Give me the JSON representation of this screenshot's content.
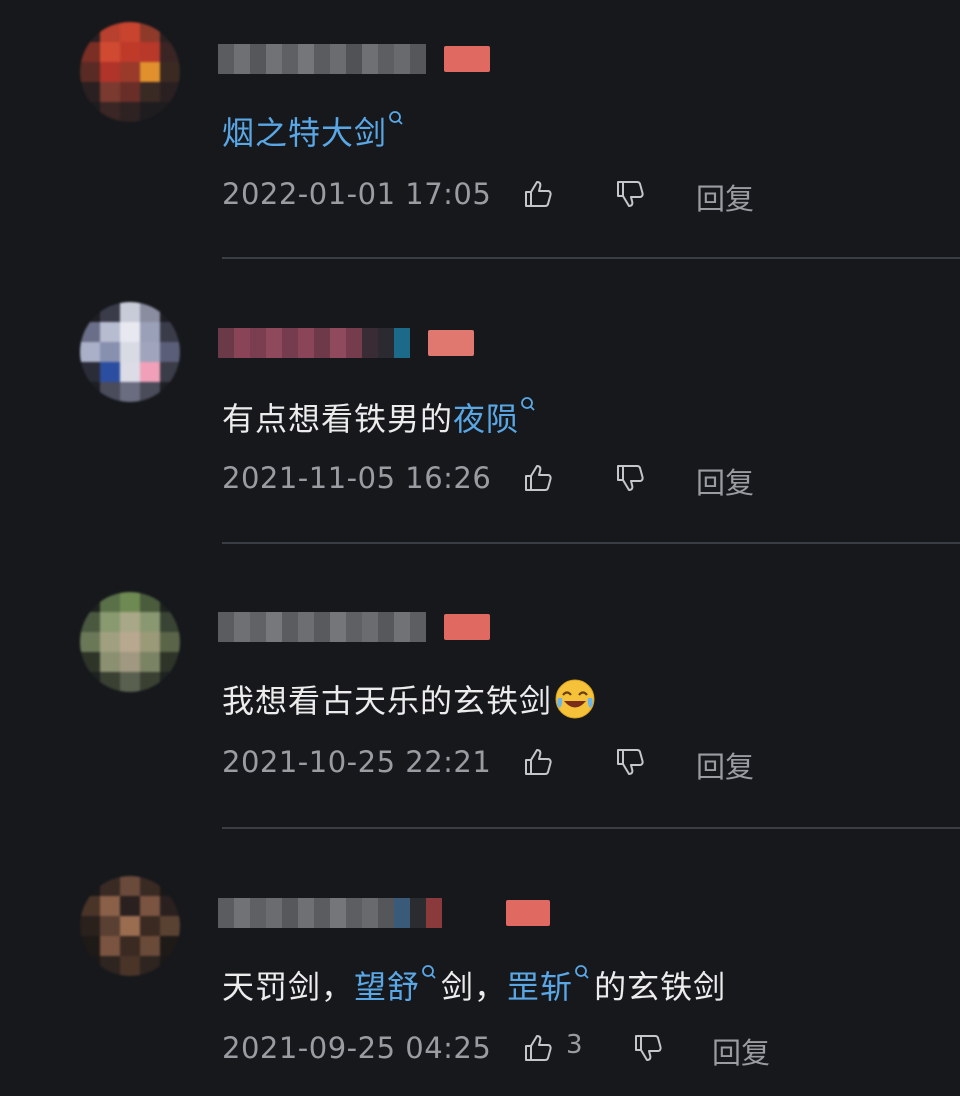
{
  "comments": [
    {
      "text_parts": [
        {
          "text": "烟之特大剑",
          "link": true
        }
      ],
      "time": "2022-01-01 17:05",
      "reply": "回复"
    },
    {
      "text_parts": [
        {
          "text": "有点想看铁男的",
          "link": false
        },
        {
          "text": "夜陨",
          "link": true
        }
      ],
      "time": "2021-11-05 16:26",
      "reply": "回复"
    },
    {
      "text_parts": [
        {
          "text": "我想看古天乐的玄铁剑",
          "link": false
        }
      ],
      "time": "2021-10-25 22:21",
      "reply": "回复"
    },
    {
      "text_parts": [
        {
          "text": "天罚剑，",
          "link": false
        },
        {
          "text": "望舒",
          "link": true
        },
        {
          "text": "剑，",
          "link": false
        },
        {
          "text": "罡斩",
          "link": true
        },
        {
          "text": "的玄铁剑",
          "link": false
        }
      ],
      "time": "2021-09-25 04:25",
      "like_count": "3",
      "reply": "回复"
    }
  ],
  "colors": {
    "background": "#16181c",
    "link": "#5aa7e6",
    "meta": "#9a9ca2",
    "divider": "#3a3d43"
  },
  "icons": {
    "like": "thumbs-up-icon",
    "dislike": "thumbs-down-icon",
    "search": "search-icon",
    "emoji": "laughing-crying-emoji"
  }
}
